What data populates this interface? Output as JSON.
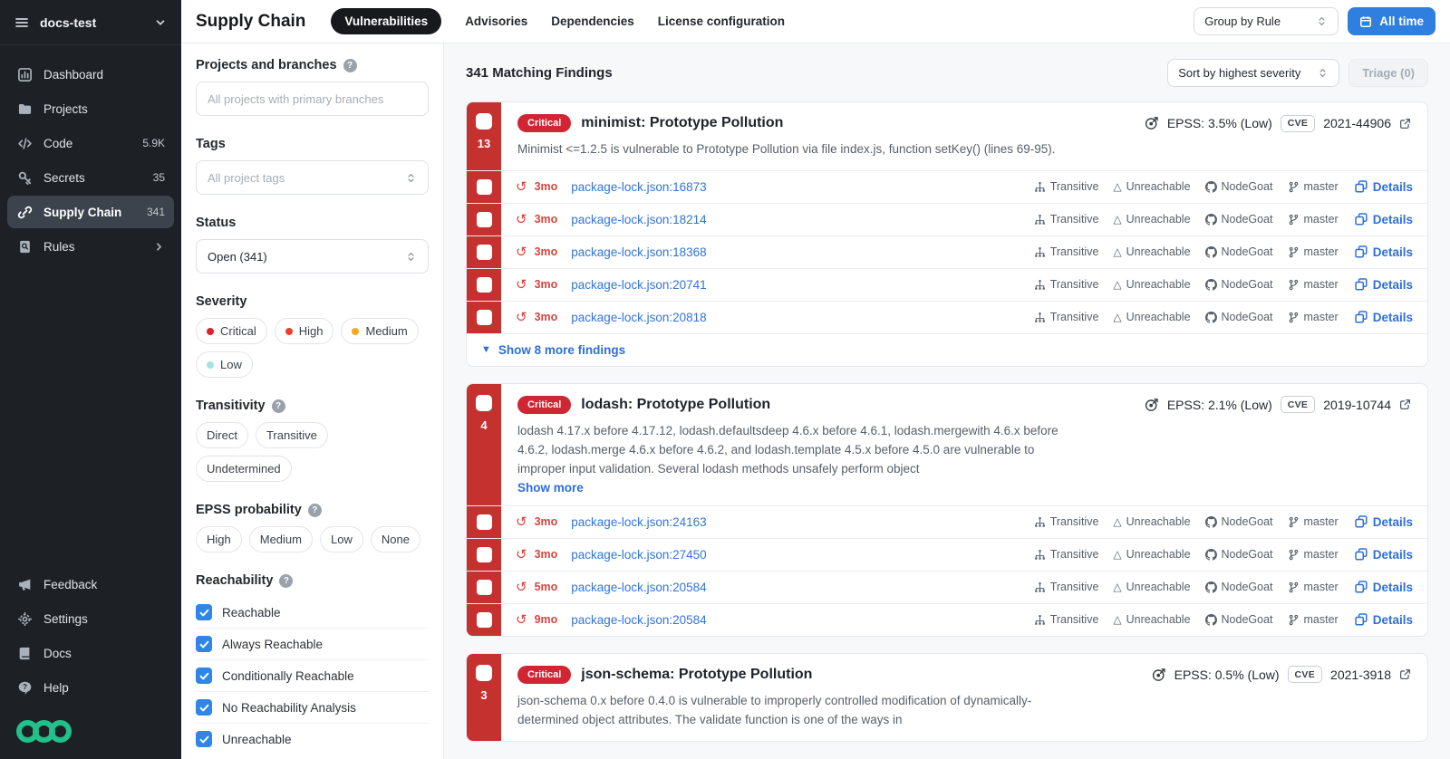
{
  "colors": {
    "accent_blue": "#2e7fe0",
    "link_blue": "#3274dc",
    "critical_red": "#c5312f",
    "checkbox_blue": "#2f86e8",
    "brand_green": "#22c08b"
  },
  "icons": {
    "history_glyph": "↺",
    "triangle_glyph": "△",
    "caret_down_glyph": "▼"
  },
  "sidebar": {
    "org": "docs-test",
    "items": [
      {
        "label": "Dashboard",
        "badge": ""
      },
      {
        "label": "Projects",
        "badge": ""
      },
      {
        "label": "Code",
        "badge": "5.9K"
      },
      {
        "label": "Secrets",
        "badge": "35"
      },
      {
        "label": "Supply Chain",
        "badge": "341"
      },
      {
        "label": "Rules",
        "badge": ""
      }
    ],
    "footer_items": [
      {
        "label": "Feedback"
      },
      {
        "label": "Settings"
      },
      {
        "label": "Docs"
      },
      {
        "label": "Help"
      }
    ]
  },
  "topbar": {
    "title": "Supply Chain",
    "tabs": [
      {
        "label": "Vulnerabilities"
      },
      {
        "label": "Advisories"
      },
      {
        "label": "Dependencies"
      },
      {
        "label": "License configuration"
      }
    ],
    "group_by": "Group by Rule",
    "time_range": "All time"
  },
  "filters": {
    "projects": {
      "label": "Projects and branches",
      "placeholder": "All projects with primary branches"
    },
    "tags": {
      "label": "Tags",
      "placeholder": "All project tags"
    },
    "status": {
      "label": "Status",
      "value": "Open (341)"
    },
    "severity": {
      "label": "Severity",
      "options": [
        {
          "label": "Critical",
          "color": "#d9242e"
        },
        {
          "label": "High",
          "color": "#e8402d"
        },
        {
          "label": "Medium",
          "color": "#f5a623"
        },
        {
          "label": "Low",
          "color": "#a5e3e0"
        }
      ]
    },
    "transitivity": {
      "label": "Transitivity",
      "options": [
        {
          "label": "Direct"
        },
        {
          "label": "Transitive"
        },
        {
          "label": "Undetermined"
        }
      ]
    },
    "epss": {
      "label": "EPSS probability",
      "options": [
        {
          "label": "High"
        },
        {
          "label": "Medium"
        },
        {
          "label": "Low"
        },
        {
          "label": "None"
        }
      ]
    },
    "reachability": {
      "label": "Reachability",
      "options": [
        {
          "label": "Reachable",
          "checked": true
        },
        {
          "label": "Always Reachable",
          "checked": true
        },
        {
          "label": "Conditionally Reachable",
          "checked": true
        },
        {
          "label": "No Reachability Analysis",
          "checked": true
        },
        {
          "label": "Unreachable",
          "checked": true
        }
      ]
    }
  },
  "main": {
    "findings_count": "341 Matching Findings",
    "sort_by": "Sort by highest severity",
    "triage_label": "Triage (0)",
    "cards": [
      {
        "count": "13",
        "severity": "Critical",
        "title": "minimist: Prototype Pollution",
        "epss": "EPSS: 3.5% (Low)",
        "cve_label": "CVE",
        "cve_id": "2021-44906",
        "description": "Minimist <=1.2.5 is vulnerable to Prototype Pollution via file index.js, function setKey() (lines 69-95).",
        "rows": [
          {
            "age": "3mo",
            "file": "package-lock.json:16873",
            "transitivity": "Transitive",
            "reachability": "Unreachable",
            "repo": "NodeGoat",
            "branch": "master",
            "details_label": "Details"
          },
          {
            "age": "3mo",
            "file": "package-lock.json:18214",
            "transitivity": "Transitive",
            "reachability": "Unreachable",
            "repo": "NodeGoat",
            "branch": "master",
            "details_label": "Details"
          },
          {
            "age": "3mo",
            "file": "package-lock.json:18368",
            "transitivity": "Transitive",
            "reachability": "Unreachable",
            "repo": "NodeGoat",
            "branch": "master",
            "details_label": "Details"
          },
          {
            "age": "3mo",
            "file": "package-lock.json:20741",
            "transitivity": "Transitive",
            "reachability": "Unreachable",
            "repo": "NodeGoat",
            "branch": "master",
            "details_label": "Details"
          },
          {
            "age": "3mo",
            "file": "package-lock.json:20818",
            "transitivity": "Transitive",
            "reachability": "Unreachable",
            "repo": "NodeGoat",
            "branch": "master",
            "details_label": "Details"
          }
        ],
        "footer": "Show 8 more findings"
      },
      {
        "count": "4",
        "severity": "Critical",
        "title": "lodash: Prototype Pollution",
        "epss": "EPSS: 2.1% (Low)",
        "cve_label": "CVE",
        "cve_id": "2019-10744",
        "description": "lodash 4.17.x before 4.17.12, lodash.defaultsdeep 4.6.x before 4.6.1, lodash.mergewith 4.6.x before 4.6.2, lodash.merge 4.6.x before 4.6.2, and lodash.template 4.5.x before 4.5.0 are vulnerable to improper input validation. Several lodash methods unsafely perform object",
        "show_more": "Show more",
        "rows": [
          {
            "age": "3mo",
            "file": "package-lock.json:24163",
            "transitivity": "Transitive",
            "reachability": "Unreachable",
            "repo": "NodeGoat",
            "branch": "master",
            "details_label": "Details"
          },
          {
            "age": "3mo",
            "file": "package-lock.json:27450",
            "transitivity": "Transitive",
            "reachability": "Unreachable",
            "repo": "NodeGoat",
            "branch": "master",
            "details_label": "Details"
          },
          {
            "age": "5mo",
            "file": "package-lock.json:20584",
            "transitivity": "Transitive",
            "reachability": "Unreachable",
            "repo": "NodeGoat",
            "branch": "master",
            "details_label": "Details"
          },
          {
            "age": "9mo",
            "file": "package-lock.json:20584",
            "transitivity": "Transitive",
            "reachability": "Unreachable",
            "repo": "NodeGoat",
            "branch": "master",
            "details_label": "Details"
          }
        ]
      },
      {
        "count": "3",
        "severity": "Critical",
        "title": "json-schema: Prototype Pollution",
        "epss": "EPSS: 0.5% (Low)",
        "cve_label": "CVE",
        "cve_id": "2021-3918",
        "description": "json-schema 0.x before 0.4.0 is vulnerable to improperly controlled modification of dynamically-determined object attributes. The validate function is one of the ways in"
      }
    ]
  }
}
